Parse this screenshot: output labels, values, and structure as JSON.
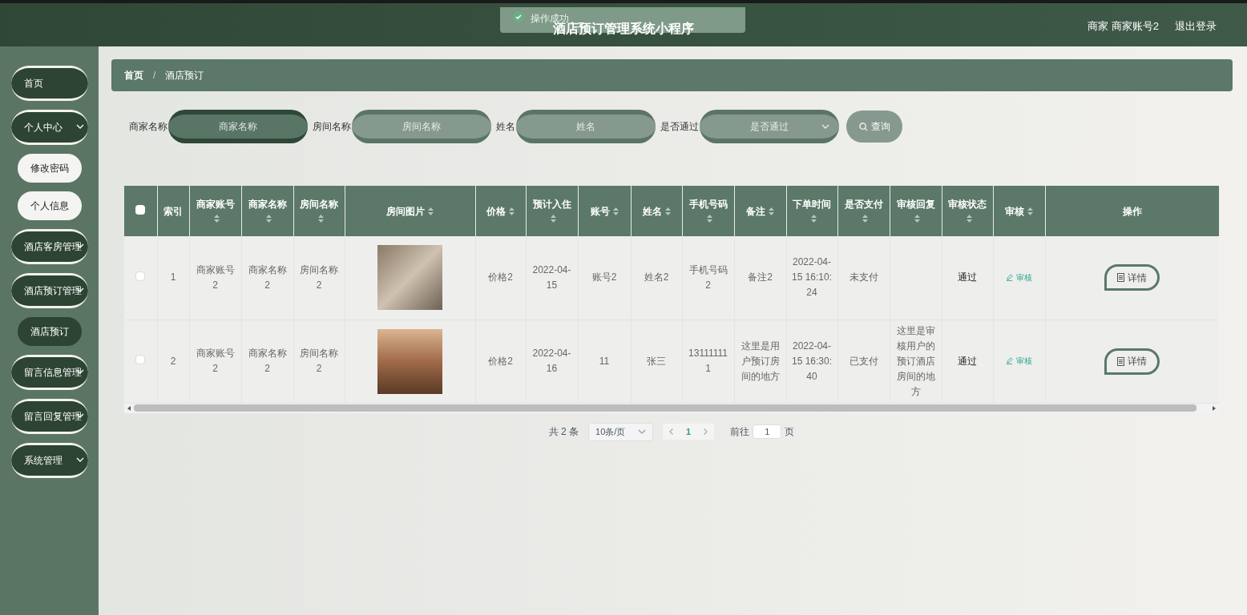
{
  "header": {
    "title": "酒店预订管理系统小程序",
    "user": "商家 商家账号2",
    "logout": "退出登录"
  },
  "toast": {
    "message": "操作成功"
  },
  "sidebar": {
    "items": [
      {
        "label": "首页",
        "kind": "group",
        "expandable": false
      },
      {
        "label": "个人中心",
        "kind": "group",
        "expandable": true
      },
      {
        "label": "修改密码",
        "kind": "sub",
        "selected": false
      },
      {
        "label": "个人信息",
        "kind": "sub",
        "selected": false
      },
      {
        "label": "酒店客房管理",
        "kind": "group",
        "expandable": true
      },
      {
        "label": "酒店预订管理",
        "kind": "group",
        "expandable": true
      },
      {
        "label": "酒店预订",
        "kind": "sub",
        "selected": true
      },
      {
        "label": "留言信息管理",
        "kind": "group",
        "expandable": true
      },
      {
        "label": "留言回复管理",
        "kind": "group",
        "expandable": true
      },
      {
        "label": "系统管理",
        "kind": "group",
        "expandable": true
      }
    ]
  },
  "breadcrumb": [
    "首页",
    "酒店预订"
  ],
  "breadcrumb_separator": "/",
  "search": {
    "fields": [
      {
        "label": "商家名称",
        "placeholder": "商家名称",
        "kind": "input"
      },
      {
        "label": "房间名称",
        "placeholder": "房间名称",
        "kind": "input"
      },
      {
        "label": "姓名",
        "placeholder": "姓名",
        "kind": "input"
      },
      {
        "label": "是否通过",
        "placeholder": "是否通过",
        "kind": "select"
      }
    ],
    "button": "查询"
  },
  "table": {
    "all_checked": false,
    "columns": [
      {
        "label": "索引",
        "sortable": false
      },
      {
        "label": "商家账号",
        "sortable": true
      },
      {
        "label": "商家名称",
        "sortable": true
      },
      {
        "label": "房间名称",
        "sortable": true
      },
      {
        "label": "房间图片",
        "sortable": true
      },
      {
        "label": "价格",
        "sortable": true
      },
      {
        "label": "预计入住",
        "sortable": true
      },
      {
        "label": "账号",
        "sortable": true
      },
      {
        "label": "姓名",
        "sortable": true
      },
      {
        "label": "手机号码",
        "sortable": true
      },
      {
        "label": "备注",
        "sortable": true
      },
      {
        "label": "下单时间",
        "sortable": true
      },
      {
        "label": "是否支付",
        "sortable": true
      },
      {
        "label": "审核回复",
        "sortable": true
      },
      {
        "label": "审核状态",
        "sortable": true
      },
      {
        "label": "审核",
        "sortable": true
      },
      {
        "label": "操作",
        "sortable": false
      }
    ],
    "rows": [
      {
        "checked": false,
        "index": "1",
        "merchant_account": "商家账号2",
        "merchant_name": "商家名称2",
        "room_name": "房间名称2",
        "price": "价格2",
        "check_in": "2022-04-15",
        "account": "账号2",
        "name": "姓名2",
        "phone": "手机号码2",
        "remark": "备注2",
        "order_time": "2022-04-15 16:10:24",
        "paid": "未支付",
        "status": "通过",
        "audit": "审核",
        "detail": "详情"
      },
      {
        "checked": false,
        "index": "2",
        "merchant_account": "商家账号2",
        "merchant_name": "商家名称2",
        "room_name": "房间名称2",
        "price": "价格2",
        "check_in": "2022-04-16",
        "account": "11",
        "name": "张三",
        "phone": "131111111",
        "remark": "这里是用户预订房间的地方",
        "order_time": "2022-04-15 16:30:40",
        "paid": "已支付",
        "reply": "这里是审核用户的预订酒店房间的地方",
        "status": "通过",
        "audit": "审核",
        "detail": "详情"
      }
    ]
  },
  "pagination": {
    "total": "共 2 条",
    "page_size": "10条/页",
    "current": "1",
    "goto_label": "前往",
    "goto_value": "1",
    "goto_suffix": "页"
  }
}
